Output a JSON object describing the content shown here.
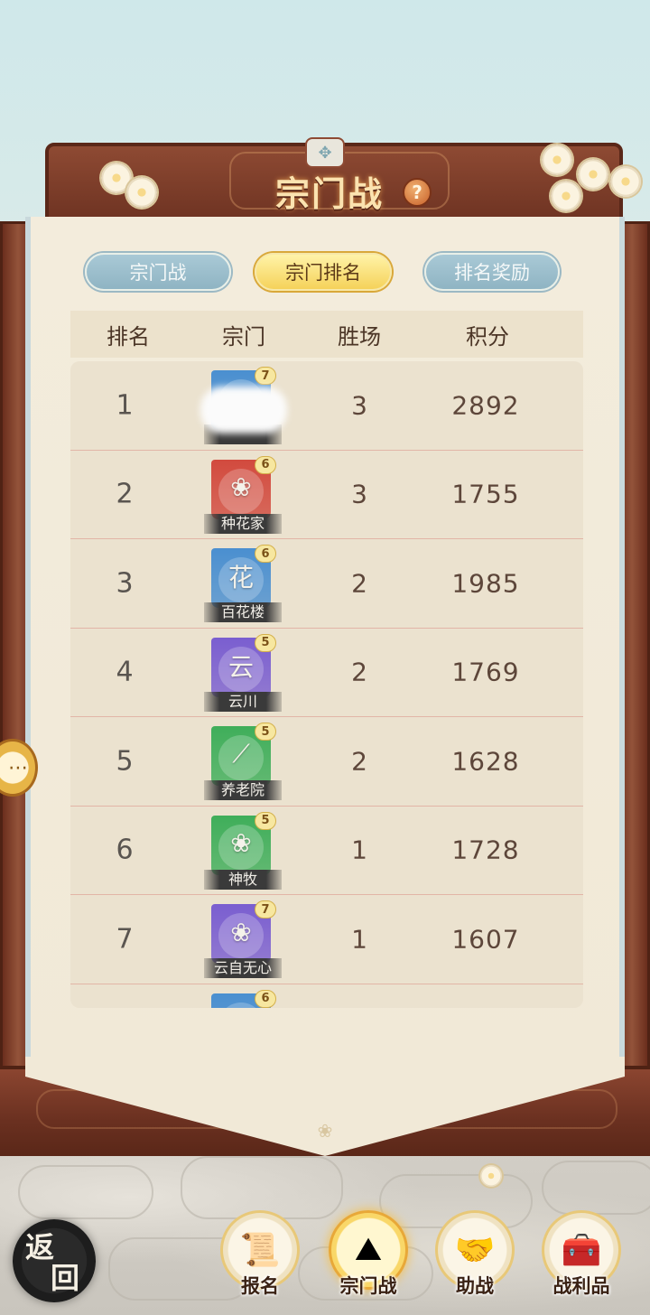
{
  "title": "宗门战",
  "tabs": [
    {
      "label": "宗门战",
      "active": false
    },
    {
      "label": "宗门排名",
      "active": true
    },
    {
      "label": "排名奖励",
      "active": false
    }
  ],
  "columns": [
    "排名",
    "宗门",
    "胜场",
    "积分"
  ],
  "rows": [
    {
      "rank": "1",
      "sect": {
        "name": "",
        "glyph": "",
        "level": "7",
        "color": "#4a8fd0",
        "obscured": true
      },
      "wins": "3",
      "points": "2892"
    },
    {
      "rank": "2",
      "sect": {
        "name": "种花家",
        "glyph": "lotus",
        "level": "6",
        "color": "#d24a3e"
      },
      "wins": "3",
      "points": "1755"
    },
    {
      "rank": "3",
      "sect": {
        "name": "百花楼",
        "glyph": "花",
        "level": "6",
        "color": "#4a8fd0"
      },
      "wins": "2",
      "points": "1985"
    },
    {
      "rank": "4",
      "sect": {
        "name": "云川",
        "glyph": "云",
        "level": "5",
        "color": "#7a5ed0"
      },
      "wins": "2",
      "points": "1769"
    },
    {
      "rank": "5",
      "sect": {
        "name": "养老院",
        "glyph": "sickle",
        "level": "5",
        "color": "#3fae5a"
      },
      "wins": "2",
      "points": "1628"
    },
    {
      "rank": "6",
      "sect": {
        "name": "神牧",
        "glyph": "lotus",
        "level": "5",
        "color": "#3fae5a"
      },
      "wins": "1",
      "points": "1728"
    },
    {
      "rank": "7",
      "sect": {
        "name": "云自无心",
        "glyph": "lotus",
        "level": "7",
        "color": "#7a5ed0"
      },
      "wins": "1",
      "points": "1607"
    },
    {
      "rank": "",
      "sect": {
        "name": "",
        "glyph": "",
        "level": "6",
        "color": "#4a8fd0",
        "partial": true
      },
      "wins": "",
      "points": ""
    }
  ],
  "nav": {
    "back_label_top": "返",
    "back_label_bottom": "回",
    "items": [
      {
        "label": "报名",
        "icon": "scroll-brush-icon",
        "active": false
      },
      {
        "label": "宗门战",
        "icon": "mountain-flag-icon",
        "active": true
      },
      {
        "label": "助战",
        "icon": "handshake-icon",
        "active": false
      },
      {
        "label": "战利品",
        "icon": "treasure-chest-icon",
        "active": false
      }
    ]
  },
  "help_icon": "question-icon",
  "side_chat_icon": "chat-bubble-icon"
}
